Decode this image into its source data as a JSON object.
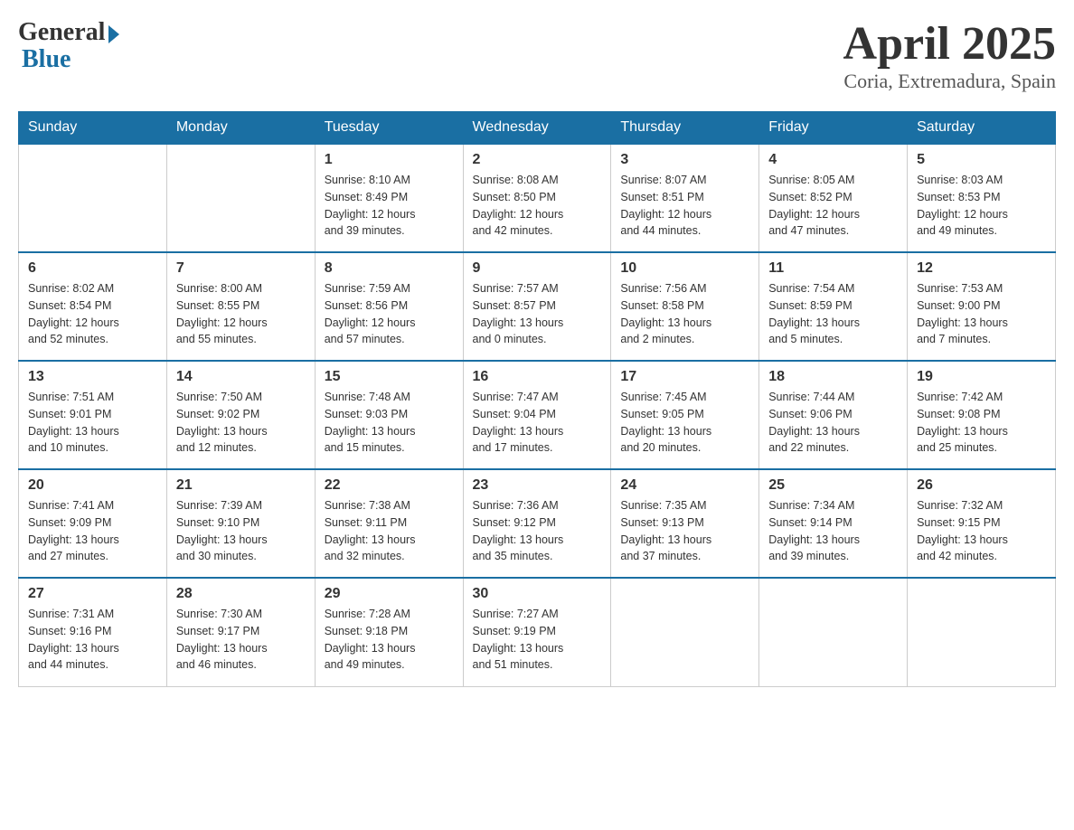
{
  "header": {
    "logo_general": "General",
    "logo_blue": "Blue",
    "month_title": "April 2025",
    "subtitle": "Coria, Extremadura, Spain"
  },
  "weekdays": [
    "Sunday",
    "Monday",
    "Tuesday",
    "Wednesday",
    "Thursday",
    "Friday",
    "Saturday"
  ],
  "weeks": [
    [
      {
        "day": "",
        "info": ""
      },
      {
        "day": "",
        "info": ""
      },
      {
        "day": "1",
        "info": "Sunrise: 8:10 AM\nSunset: 8:49 PM\nDaylight: 12 hours\nand 39 minutes."
      },
      {
        "day": "2",
        "info": "Sunrise: 8:08 AM\nSunset: 8:50 PM\nDaylight: 12 hours\nand 42 minutes."
      },
      {
        "day": "3",
        "info": "Sunrise: 8:07 AM\nSunset: 8:51 PM\nDaylight: 12 hours\nand 44 minutes."
      },
      {
        "day": "4",
        "info": "Sunrise: 8:05 AM\nSunset: 8:52 PM\nDaylight: 12 hours\nand 47 minutes."
      },
      {
        "day": "5",
        "info": "Sunrise: 8:03 AM\nSunset: 8:53 PM\nDaylight: 12 hours\nand 49 minutes."
      }
    ],
    [
      {
        "day": "6",
        "info": "Sunrise: 8:02 AM\nSunset: 8:54 PM\nDaylight: 12 hours\nand 52 minutes."
      },
      {
        "day": "7",
        "info": "Sunrise: 8:00 AM\nSunset: 8:55 PM\nDaylight: 12 hours\nand 55 minutes."
      },
      {
        "day": "8",
        "info": "Sunrise: 7:59 AM\nSunset: 8:56 PM\nDaylight: 12 hours\nand 57 minutes."
      },
      {
        "day": "9",
        "info": "Sunrise: 7:57 AM\nSunset: 8:57 PM\nDaylight: 13 hours\nand 0 minutes."
      },
      {
        "day": "10",
        "info": "Sunrise: 7:56 AM\nSunset: 8:58 PM\nDaylight: 13 hours\nand 2 minutes."
      },
      {
        "day": "11",
        "info": "Sunrise: 7:54 AM\nSunset: 8:59 PM\nDaylight: 13 hours\nand 5 minutes."
      },
      {
        "day": "12",
        "info": "Sunrise: 7:53 AM\nSunset: 9:00 PM\nDaylight: 13 hours\nand 7 minutes."
      }
    ],
    [
      {
        "day": "13",
        "info": "Sunrise: 7:51 AM\nSunset: 9:01 PM\nDaylight: 13 hours\nand 10 minutes."
      },
      {
        "day": "14",
        "info": "Sunrise: 7:50 AM\nSunset: 9:02 PM\nDaylight: 13 hours\nand 12 minutes."
      },
      {
        "day": "15",
        "info": "Sunrise: 7:48 AM\nSunset: 9:03 PM\nDaylight: 13 hours\nand 15 minutes."
      },
      {
        "day": "16",
        "info": "Sunrise: 7:47 AM\nSunset: 9:04 PM\nDaylight: 13 hours\nand 17 minutes."
      },
      {
        "day": "17",
        "info": "Sunrise: 7:45 AM\nSunset: 9:05 PM\nDaylight: 13 hours\nand 20 minutes."
      },
      {
        "day": "18",
        "info": "Sunrise: 7:44 AM\nSunset: 9:06 PM\nDaylight: 13 hours\nand 22 minutes."
      },
      {
        "day": "19",
        "info": "Sunrise: 7:42 AM\nSunset: 9:08 PM\nDaylight: 13 hours\nand 25 minutes."
      }
    ],
    [
      {
        "day": "20",
        "info": "Sunrise: 7:41 AM\nSunset: 9:09 PM\nDaylight: 13 hours\nand 27 minutes."
      },
      {
        "day": "21",
        "info": "Sunrise: 7:39 AM\nSunset: 9:10 PM\nDaylight: 13 hours\nand 30 minutes."
      },
      {
        "day": "22",
        "info": "Sunrise: 7:38 AM\nSunset: 9:11 PM\nDaylight: 13 hours\nand 32 minutes."
      },
      {
        "day": "23",
        "info": "Sunrise: 7:36 AM\nSunset: 9:12 PM\nDaylight: 13 hours\nand 35 minutes."
      },
      {
        "day": "24",
        "info": "Sunrise: 7:35 AM\nSunset: 9:13 PM\nDaylight: 13 hours\nand 37 minutes."
      },
      {
        "day": "25",
        "info": "Sunrise: 7:34 AM\nSunset: 9:14 PM\nDaylight: 13 hours\nand 39 minutes."
      },
      {
        "day": "26",
        "info": "Sunrise: 7:32 AM\nSunset: 9:15 PM\nDaylight: 13 hours\nand 42 minutes."
      }
    ],
    [
      {
        "day": "27",
        "info": "Sunrise: 7:31 AM\nSunset: 9:16 PM\nDaylight: 13 hours\nand 44 minutes."
      },
      {
        "day": "28",
        "info": "Sunrise: 7:30 AM\nSunset: 9:17 PM\nDaylight: 13 hours\nand 46 minutes."
      },
      {
        "day": "29",
        "info": "Sunrise: 7:28 AM\nSunset: 9:18 PM\nDaylight: 13 hours\nand 49 minutes."
      },
      {
        "day": "30",
        "info": "Sunrise: 7:27 AM\nSunset: 9:19 PM\nDaylight: 13 hours\nand 51 minutes."
      },
      {
        "day": "",
        "info": ""
      },
      {
        "day": "",
        "info": ""
      },
      {
        "day": "",
        "info": ""
      }
    ]
  ]
}
